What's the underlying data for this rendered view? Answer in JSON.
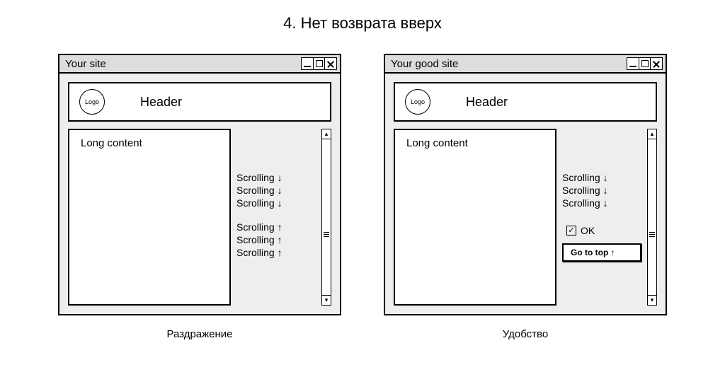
{
  "title": "4. Нет возврата вверх",
  "left": {
    "window_title": "Your site",
    "logo": "Logo",
    "header": "Header",
    "content": "Long content",
    "scroll_down": [
      "Scrolling ↓",
      "Scrolling ↓",
      "Scrolling ↓"
    ],
    "scroll_up": [
      "Scrolling ↑",
      "Scrolling ↑",
      "Scrolling ↑"
    ],
    "caption": "Раздражение"
  },
  "right": {
    "window_title": "Your good site",
    "logo": "Logo",
    "header": "Header",
    "content": "Long content",
    "scroll_down": [
      "Scrolling ↓",
      "Scrolling ↓",
      "Scrolling ↓"
    ],
    "ok_label": "OK",
    "goto_top": "Go to top ↑",
    "caption": "Удобство"
  }
}
